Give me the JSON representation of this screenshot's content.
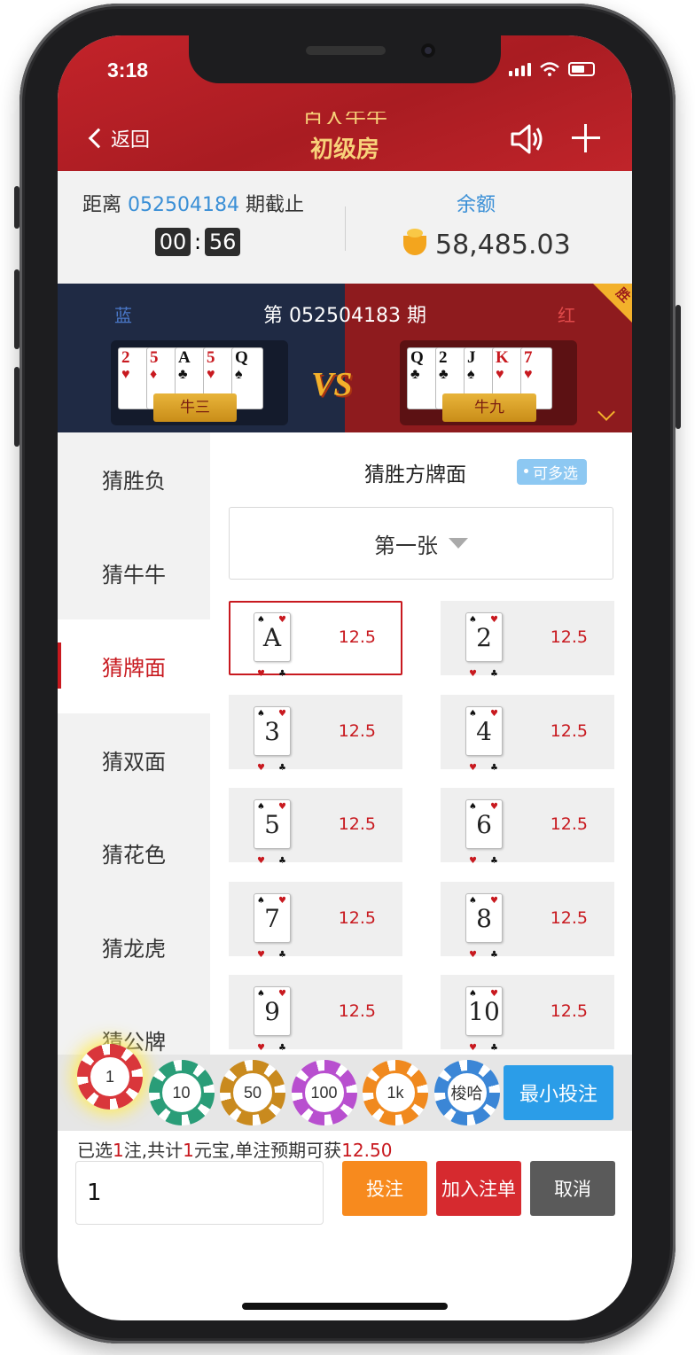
{
  "status_bar": {
    "time": "3:18"
  },
  "header": {
    "back_label": "返回",
    "room_title": "初级房",
    "room_title_partial": "百人牛牛",
    "icons": [
      "speaker-icon",
      "plus-icon"
    ]
  },
  "info": {
    "deadline_prefix": "距离",
    "deadline_issue": "052504184",
    "deadline_suffix": "期截止",
    "countdown_min": "00",
    "countdown_sep": ":",
    "countdown_sec": "56",
    "balance_label": "余额",
    "balance_value": "58,485.03"
  },
  "result": {
    "issue_label": "第 052504183 期",
    "blue_label": "蓝",
    "red_label": "红",
    "vs_text": "VS",
    "winner_badge": "胜",
    "blue_hand": {
      "cards": [
        {
          "rank": "2",
          "suit": "♥"
        },
        {
          "rank": "5",
          "suit": "♦"
        },
        {
          "rank": "A",
          "suit": "♣"
        },
        {
          "rank": "5",
          "suit": "♥"
        },
        {
          "rank": "Q",
          "suit": "♠"
        }
      ],
      "result": "牛三"
    },
    "red_hand": {
      "cards": [
        {
          "rank": "Q",
          "suit": "♣"
        },
        {
          "rank": "2",
          "suit": "♣"
        },
        {
          "rank": "J",
          "suit": "♠"
        },
        {
          "rank": "K",
          "suit": "♥"
        },
        {
          "rank": "7",
          "suit": "♥"
        }
      ],
      "result": "牛九"
    }
  },
  "sidebar": {
    "items": [
      {
        "label": "猜胜负",
        "active": false
      },
      {
        "label": "猜牛牛",
        "active": false
      },
      {
        "label": "猜牌面",
        "active": true
      },
      {
        "label": "猜双面",
        "active": false
      },
      {
        "label": "猜花色",
        "active": false
      },
      {
        "label": "猜龙虎",
        "active": false
      },
      {
        "label": "猜公牌",
        "active": false
      }
    ]
  },
  "main": {
    "title": "猜胜方牌面",
    "multi_badge": "可多选",
    "select_value": "第一张",
    "cells": [
      {
        "rank": "A",
        "odds": "12.5",
        "selected": true
      },
      {
        "rank": "2",
        "odds": "12.5",
        "selected": false
      },
      {
        "rank": "3",
        "odds": "12.5",
        "selected": false
      },
      {
        "rank": "4",
        "odds": "12.5",
        "selected": false
      },
      {
        "rank": "5",
        "odds": "12.5",
        "selected": false
      },
      {
        "rank": "6",
        "odds": "12.5",
        "selected": false
      },
      {
        "rank": "7",
        "odds": "12.5",
        "selected": false
      },
      {
        "rank": "8",
        "odds": "12.5",
        "selected": false
      },
      {
        "rank": "9",
        "odds": "12.5",
        "selected": false
      },
      {
        "rank": "10",
        "odds": "12.5",
        "selected": false
      }
    ]
  },
  "chips": {
    "items": [
      {
        "label": "1",
        "color": "#d9363b",
        "active": true
      },
      {
        "label": "10",
        "color": "#2a9d78",
        "active": false
      },
      {
        "label": "50",
        "color": "#c98a1e",
        "active": false
      },
      {
        "label": "100",
        "color": "#b84fcf",
        "active": false
      },
      {
        "label": "1k",
        "color": "#f0891e",
        "active": false
      },
      {
        "label": "梭哈",
        "color": "#3b86d6",
        "active": false
      }
    ],
    "min_bet_label": "最小投注"
  },
  "bet": {
    "summary_1": "已选",
    "summary_count": "1",
    "summary_2": "注,共计",
    "summary_total": "1",
    "summary_3": "元宝,单注预期可获",
    "summary_expect": "12.50",
    "amount_value": "1",
    "place_label": "投注",
    "add_label": "加入注单",
    "cancel_label": "取消"
  },
  "colors": {
    "brand_red": "#c8191f",
    "accent_blue": "#3a8fd6",
    "place_orange": "#f78a1e",
    "add_red": "#d62a2f",
    "cancel_gray": "#5a5a5a"
  }
}
